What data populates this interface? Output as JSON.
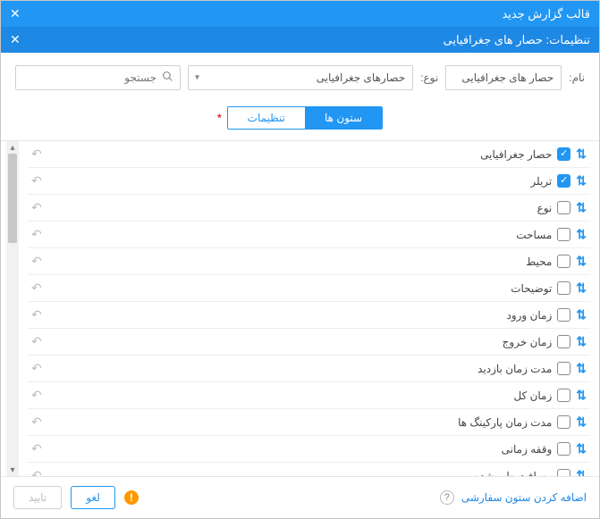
{
  "header": {
    "title": "قالب گزارش جدید",
    "subtitle": "تنظیمات: حصار های جغرافیایی"
  },
  "form": {
    "name_label": "نام:",
    "name_value": "حصار های جغرافیایی",
    "type_label": "نوع:",
    "type_value": "حصارهای جغرافیایی",
    "search_placeholder": "جستجو"
  },
  "tabs": {
    "columns": "ستون ها",
    "settings": "تنظیمات"
  },
  "columns": [
    {
      "label": "حصار جغرافیایی",
      "checked": true
    },
    {
      "label": "تریلر",
      "checked": true
    },
    {
      "label": "نوع",
      "checked": false
    },
    {
      "label": "مساحت",
      "checked": false
    },
    {
      "label": "محیط",
      "checked": false
    },
    {
      "label": "توضیحات",
      "checked": false
    },
    {
      "label": "زمان ورود",
      "checked": false
    },
    {
      "label": "زمان خروج",
      "checked": false
    },
    {
      "label": "مدت زمان بازدید",
      "checked": false
    },
    {
      "label": "زمان کل",
      "checked": false
    },
    {
      "label": "مدت زمان پارکینگ ها",
      "checked": false
    },
    {
      "label": "وقفه زمانی",
      "checked": false
    },
    {
      "label": "مسافت طی شده",
      "checked": false
    }
  ],
  "footer": {
    "add_custom": "اضافه کردن ستون سفارشی",
    "cancel": "لغو",
    "confirm": "تایید"
  }
}
